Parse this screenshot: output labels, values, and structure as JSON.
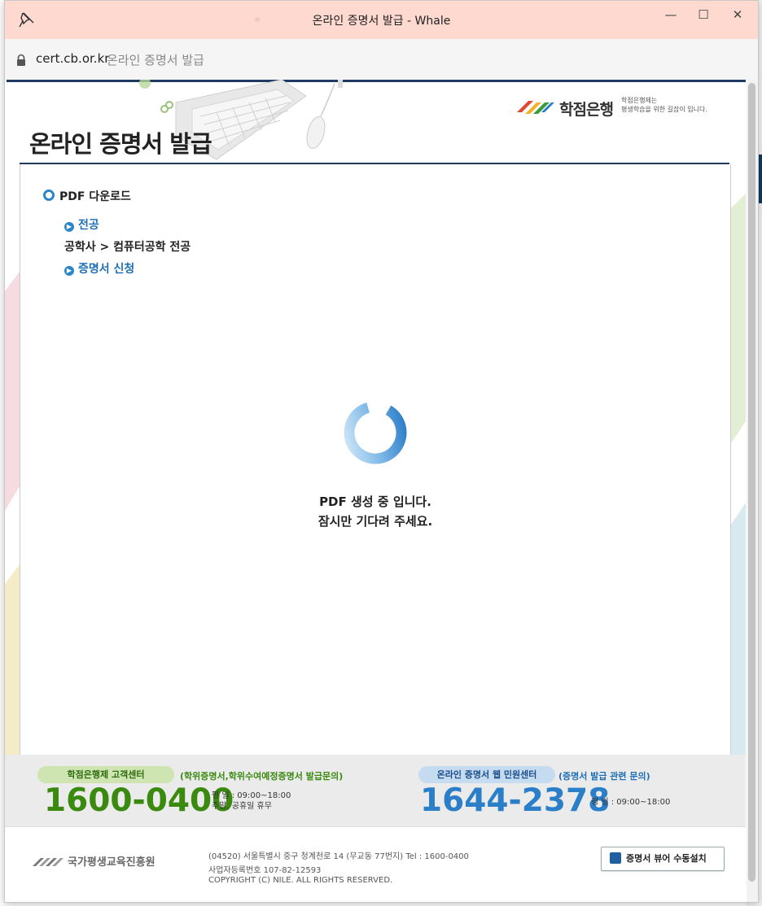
{
  "window": {
    "title": "온라인 증명서 발급 - Whale",
    "minimize": "—",
    "maximize": "☐",
    "close": "✕"
  },
  "address": {
    "domain": "cert.cb.or.kr",
    "page_title": "온라인 증명서 발급"
  },
  "header": {
    "title": "온라인 증명서 발급",
    "brand_name": "학점은행",
    "brand_slogan_1": "학점은행제는",
    "brand_slogan_2": "평생학습을 위한 길잡이 입니다."
  },
  "section": {
    "heading": "PDF 다운로드",
    "major_link": "전공",
    "major_value": "공학사 > 컴퓨터공학 전공",
    "apply_link": "증명서 신청"
  },
  "loading": {
    "line1": "PDF 생성 중 입니다.",
    "line2": "잠시만 기다려 주세요."
  },
  "footer": {
    "center1_label": "학점은행제 고객센터",
    "center1_note": "(학위증명서,학위수여예정증명서 발급문의)",
    "center1_phone": "1600-0400",
    "center1_hours_weekday": "평   일 : 09:00~18:00",
    "center1_hours_weekend": "주말, 공휴일 휴무",
    "center2_label": "온라인 증명서 웹 민원센터",
    "center2_note": "(증명서 발급 관련 문의)",
    "center2_phone": "1644-2378",
    "center2_hours_weekday": "평   일 : 09:00~18:00"
  },
  "bottom": {
    "org_name": "국가평생교육진흥원",
    "address": "(04520) 서울특별시 중구 청계천로 14 (무교동 77번지)   Tel : 1600-0400",
    "biz_no": "사업자등록번호 107-82-12593",
    "copyright": "COPYRIGHT (C) NILE. ALL RIGHTS RESERVED.",
    "viewer_button": "증명서 뷰어 수동설치"
  },
  "colors": {
    "titlebar": "#fdd9cf",
    "navy": "#1f3b62",
    "link_blue": "#1f6fb5",
    "phone_green": "#3a8a10",
    "phone_blue": "#2a7fc8"
  }
}
